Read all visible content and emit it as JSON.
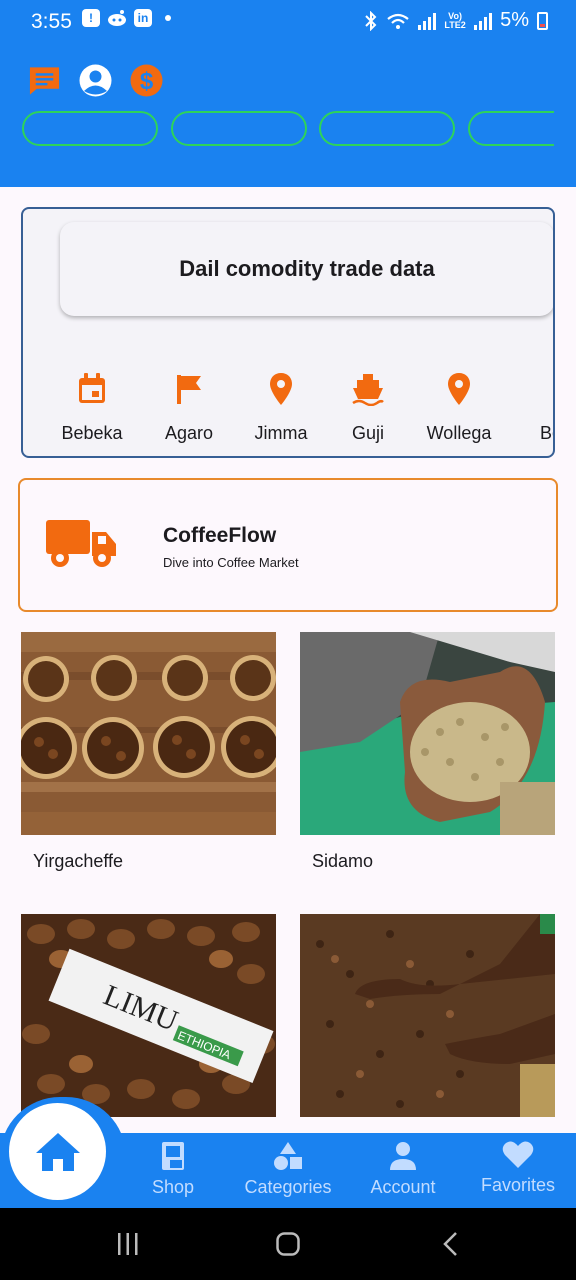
{
  "status_bar": {
    "time": "3:55",
    "network_label": "Vo) LTE2",
    "battery": "5%"
  },
  "header": {
    "icons": [
      "chat-icon",
      "account-circle-icon",
      "dollar-icon"
    ],
    "pill_count": 4
  },
  "trade_card": {
    "title": "Dail comodity trade data",
    "regions": [
      {
        "label": "Bebeka",
        "icon": "calendar-icon"
      },
      {
        "label": "Agaro",
        "icon": "flag-icon"
      },
      {
        "label": "Jimma",
        "icon": "location-pin-icon"
      },
      {
        "label": "Guji",
        "icon": "ship-icon"
      },
      {
        "label": "Wollega",
        "icon": "location-pin-icon"
      },
      {
        "label": "Be",
        "icon": "location-pin-icon"
      }
    ]
  },
  "coffeeflow": {
    "icon": "truck-icon",
    "title": "CoffeeFlow",
    "subtitle": "Dive into Coffee Market"
  },
  "products": [
    {
      "label": "Yirgacheffe",
      "image": "coffee-bowls-image"
    },
    {
      "label": "Sidamo",
      "image": "green-beans-hands-image"
    },
    {
      "label": "",
      "image": "limu-ethiopia-beans-image",
      "image_text": "LIMU ETHIOPIA"
    },
    {
      "label": "",
      "image": "beans-drying-image"
    }
  ],
  "bottom_nav": {
    "items": [
      {
        "label": "",
        "icon": "home-icon",
        "active": true
      },
      {
        "label": "Shop",
        "icon": "shop-icon"
      },
      {
        "label": "Categories",
        "icon": "categories-icon"
      },
      {
        "label": "Account",
        "icon": "person-icon"
      },
      {
        "label": "Favorites",
        "icon": "heart-icon"
      }
    ]
  },
  "colors": {
    "primary": "#1a82f0",
    "accent_orange": "#f26a10",
    "pill_green": "#2ed35a",
    "card_border_blue": "#375f95",
    "card_border_orange": "#e88a2c"
  }
}
